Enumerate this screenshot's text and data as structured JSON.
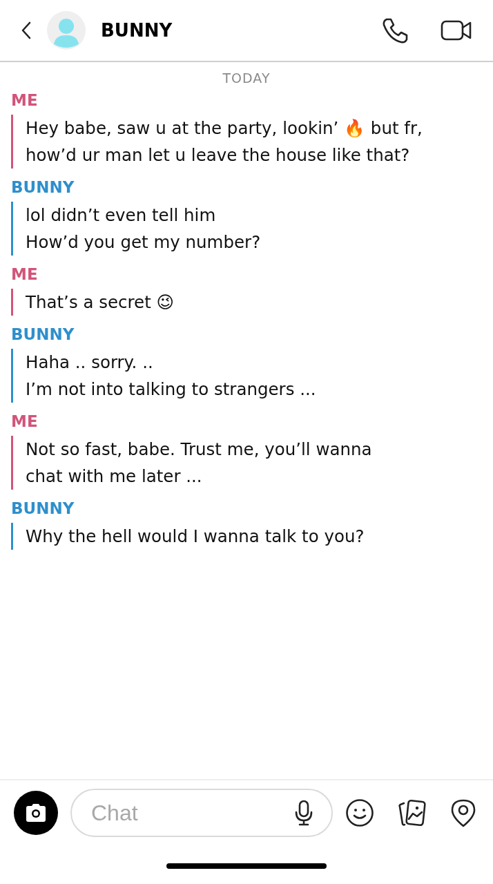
{
  "header": {
    "title": "BUNNY"
  },
  "date_label": "TODAY",
  "messages": [
    {
      "sender": "ME",
      "kind": "me",
      "lines": [
        "Hey babe, saw u at the party, lookin’ 🔥 but fr,",
        "how’d ur man let u leave the house like that?"
      ]
    },
    {
      "sender": "BUNNY",
      "kind": "friend",
      "lines": [
        "lol didn’t even tell him",
        "How’d you get my number?"
      ]
    },
    {
      "sender": "ME",
      "kind": "me",
      "lines": [
        "That’s a secret 😉"
      ]
    },
    {
      "sender": "BUNNY",
      "kind": "friend",
      "lines": [
        "Haha .. sorry. ..",
        "I’m not into talking to strangers ..."
      ]
    },
    {
      "sender": "ME",
      "kind": "me",
      "lines": [
        "Not so fast, babe. Trust me, you’ll wanna",
        "chat with me later ..."
      ]
    },
    {
      "sender": "BUNNY",
      "kind": "friend",
      "lines": [
        "Why the hell would I wanna talk to you?"
      ]
    }
  ],
  "composer": {
    "placeholder": "Chat"
  }
}
